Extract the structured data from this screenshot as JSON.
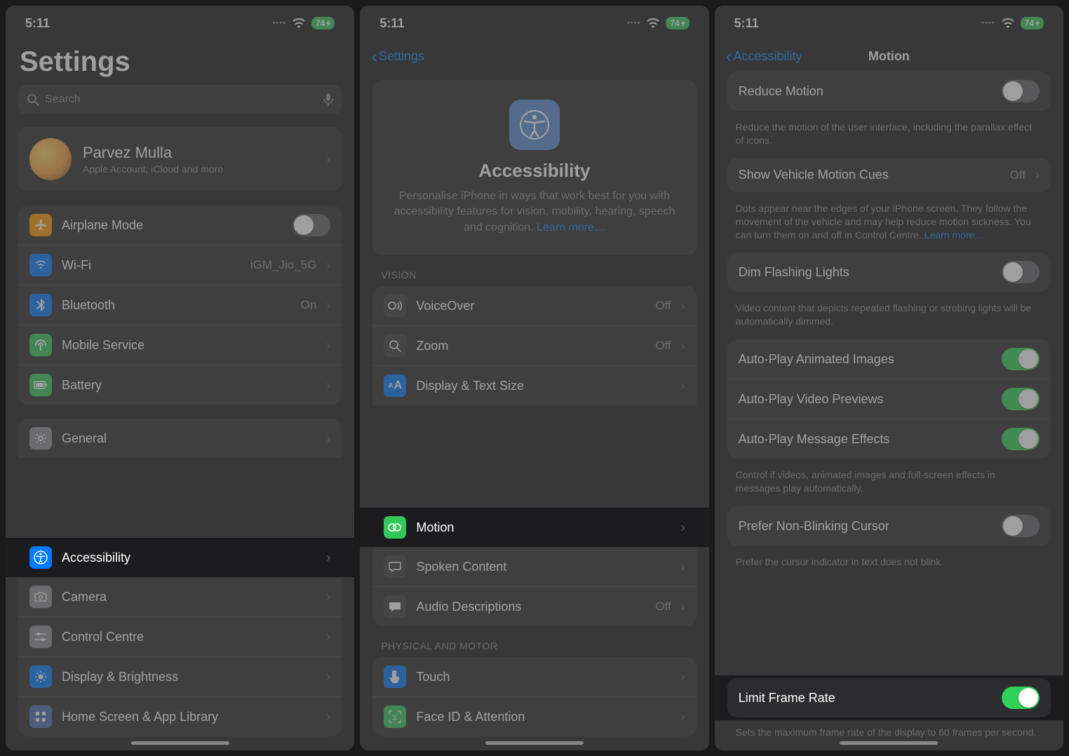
{
  "status": {
    "time": "5:11",
    "battery": "74"
  },
  "s1": {
    "title": "Settings",
    "search_placeholder": "Search",
    "account": {
      "name": "Parvez Mulla",
      "sub": "Apple Account, iCloud and more"
    },
    "rows": {
      "airplane": "Airplane Mode",
      "wifi": "Wi-Fi",
      "wifi_val": "iGM_Jio_5G",
      "bluetooth": "Bluetooth",
      "bluetooth_val": "On",
      "mobile": "Mobile Service",
      "battery": "Battery",
      "general": "General",
      "accessibility": "Accessibility",
      "camera": "Camera",
      "control_centre": "Control Centre",
      "display": "Display & Brightness",
      "home_screen": "Home Screen & App Library"
    }
  },
  "s2": {
    "back": "Settings",
    "hero_title": "Accessibility",
    "hero_body": "Personalise iPhone in ways that work best for you with accessibility features for vision, mobility, hearing, speech and cognition.",
    "hero_link": "Learn more…",
    "section_vision": "VISION",
    "section_motor": "PHYSICAL AND MOTOR",
    "rows": {
      "voiceover": "VoiceOver",
      "voiceover_val": "Off",
      "zoom": "Zoom",
      "zoom_val": "Off",
      "display_text": "Display & Text Size",
      "motion": "Motion",
      "spoken": "Spoken Content",
      "audio_desc": "Audio Descriptions",
      "audio_desc_val": "Off",
      "touch": "Touch",
      "faceid": "Face ID & Attention"
    }
  },
  "s3": {
    "back": "Accessibility",
    "title": "Motion",
    "rows": {
      "reduce_motion": "Reduce Motion",
      "reduce_motion_footer": "Reduce the motion of the user interface, including the parallax effect of icons.",
      "vehicle_cues": "Show Vehicle Motion Cues",
      "vehicle_cues_val": "Off",
      "vehicle_cues_footer1": "Dots appear near the edges of your iPhone screen. They follow the movement of the vehicle and may help reduce motion sickness. You can turn them on and off in Control Centre.",
      "vehicle_cues_link": "Learn more…",
      "dim_flashing": "Dim Flashing Lights",
      "dim_flashing_footer": "Video content that depicts repeated flashing or strobing lights will be automatically dimmed.",
      "autoplay_img": "Auto-Play Animated Images",
      "autoplay_video": "Auto-Play Video Previews",
      "autoplay_msg": "Auto-Play Message Effects",
      "autoplay_footer": "Control if videos, animated images and full-screen effects in messages play automatically.",
      "cursor": "Prefer Non-Blinking Cursor",
      "cursor_footer": "Prefer the cursor indicator in text does not blink.",
      "limit_fr": "Limit Frame Rate",
      "limit_fr_footer": "Sets the maximum frame rate of the display to 60 frames per second."
    }
  }
}
